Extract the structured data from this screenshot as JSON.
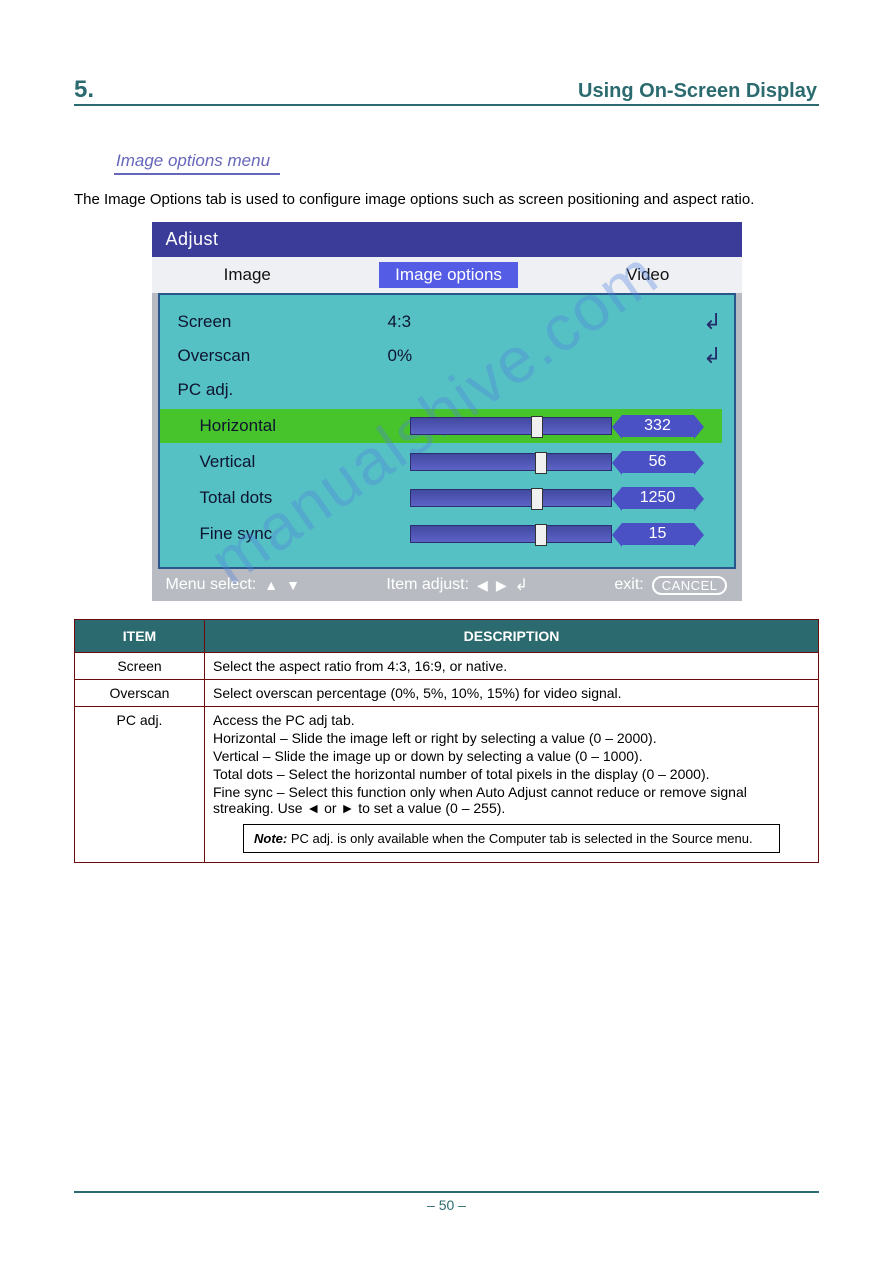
{
  "header": {
    "chapter_num": "5.",
    "chapter_title": "Using On-Screen Display"
  },
  "section_link": "Image options menu",
  "intro": "The Image Options tab is used to configure image options such as screen positioning and aspect ratio.",
  "osd": {
    "title": "Adjust",
    "tabs": [
      "Image",
      "Image options",
      "Video"
    ],
    "tab_selected_index": 1,
    "screen_label": "Screen",
    "screen_value": "4:3",
    "overscan_label": "Overscan",
    "overscan_value": "0%",
    "pcadj_label": "PC adj.",
    "sliders": [
      {
        "label": "Horizontal",
        "value": "332",
        "pos_pct": 60,
        "highlight": true
      },
      {
        "label": "Vertical",
        "value": "56",
        "pos_pct": 62,
        "highlight": false
      },
      {
        "label": "Total dots",
        "value": "1250",
        "pos_pct": 60,
        "highlight": false
      },
      {
        "label": "Fine sync",
        "value": "15",
        "pos_pct": 62,
        "highlight": false
      }
    ],
    "footer": {
      "menu_select": "Menu select:",
      "item_adjust": "Item adjust:",
      "exit": "exit:",
      "cancel": "CANCEL"
    }
  },
  "table": {
    "head_item": "ITEM",
    "head_desc": "DESCRIPTION",
    "screen_name": "Screen",
    "screen_desc": "Select the aspect ratio from 4:3, 16:9, or native.",
    "overscan_name": "Overscan",
    "overscan_desc": "Select overscan percentage (0%, 5%, 10%, 15%) for video signal.",
    "pcadj_name": "PC adj.",
    "pcadj_desc": "Access the PC adj tab.",
    "pcadj_sub": [
      "Horizontal – Slide the image left or right by selecting a value (0 – 2000).",
      "Vertical – Slide the image up or down by selecting a value (0 – 1000).",
      "Total dots – Select the horizontal number of total pixels in the display (0 – 2000).",
      "Fine sync – Select this function only when Auto Adjust cannot reduce or remove signal streaking. Use ◄ or ► to set a value (0 – 255)."
    ],
    "note_label": "Note:",
    "note_text": "PC adj. is only available when the Computer tab is selected in the Source menu."
  },
  "watermark": "manualshive.com",
  "page_number": "– 50 –"
}
